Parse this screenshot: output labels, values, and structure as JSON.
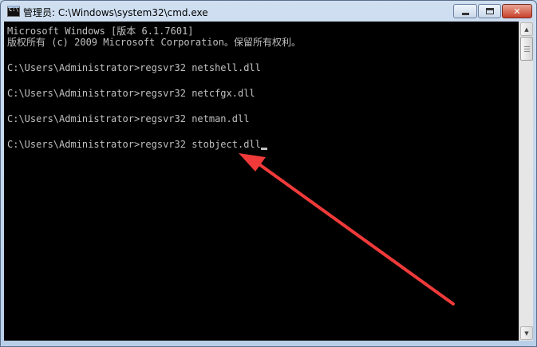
{
  "window": {
    "title": "管理员: C:\\Windows\\system32\\cmd.exe",
    "icon": "cmd-icon"
  },
  "controls": {
    "minimize_icon": "minimize-icon",
    "maximize_icon": "maximize-icon",
    "close_glyph": "✕"
  },
  "console": {
    "lines": [
      "Microsoft Windows [版本 6.1.7601]",
      "版权所有 (c) 2009 Microsoft Corporation。保留所有权利。",
      "",
      "C:\\Users\\Administrator>regsvr32 netshell.dll",
      "",
      "C:\\Users\\Administrator>regsvr32 netcfgx.dll",
      "",
      "C:\\Users\\Administrator>regsvr32 netman.dll",
      "",
      "C:\\Users\\Administrator>regsvr32 stobject.dll"
    ]
  },
  "scrollbar": {
    "up_glyph": "▲",
    "down_glyph": "▼"
  },
  "colors": {
    "console_bg": "#000000",
    "console_text": "#c0c0c0",
    "annotation_arrow": "#f03a3a",
    "close_button": "#c8412b"
  }
}
